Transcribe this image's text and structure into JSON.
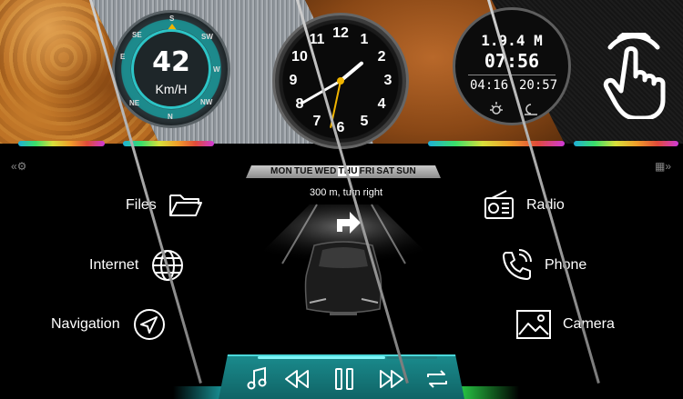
{
  "dashboard": {
    "speed": {
      "value": "42",
      "unit": "Km/H"
    },
    "compass": {
      "labels": [
        "S",
        "SW",
        "W",
        "NW",
        "N",
        "NE",
        "E",
        "SE"
      ]
    },
    "analog_clock": {
      "numerals": [
        "12",
        "1",
        "2",
        "3",
        "4",
        "5",
        "6",
        "7",
        "8",
        "9",
        "10",
        "11"
      ],
      "hour": 1,
      "minute": 40,
      "second": 32
    },
    "digital_clock": {
      "top": "1.9.4 M",
      "time": "07:56",
      "sub_left": "04:16",
      "sub_right": "20:57"
    }
  },
  "days": {
    "items": [
      "MON",
      "TUE",
      "WED",
      "THU",
      "FRI",
      "SAT",
      "SUN"
    ],
    "today": "THU"
  },
  "menu": {
    "left": [
      {
        "label": "Files",
        "icon": "folder-icon"
      },
      {
        "label": "Internet",
        "icon": "globe-icon"
      },
      {
        "label": "Navigation",
        "icon": "navigation-arrow-icon"
      }
    ],
    "right": [
      {
        "label": "Radio",
        "icon": "radio-icon"
      },
      {
        "label": "Phone",
        "icon": "phone-icon"
      },
      {
        "label": "Camera",
        "icon": "camera-icon"
      }
    ]
  },
  "navigation": {
    "hint": "300 m, turn right"
  },
  "media": {
    "buttons": [
      "music-note-icon",
      "rewind-icon",
      "pause-icon",
      "fast-forward-icon",
      "repeat-icon"
    ],
    "progress": 0.72
  },
  "colors": {
    "accent": "#2cc4c6",
    "bar": "#1a8a8c",
    "wood": "#b86c22"
  }
}
